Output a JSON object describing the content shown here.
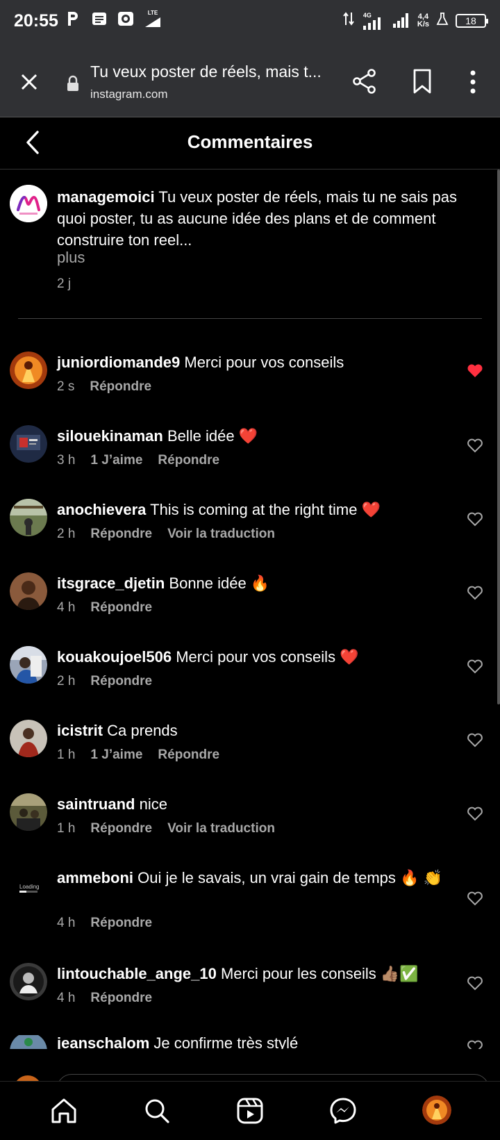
{
  "status_bar": {
    "time": "20:55",
    "lte": "LTE",
    "net_4g": "4G",
    "speed": "4,4",
    "speed_unit": "K/s",
    "battery": "18"
  },
  "browser": {
    "tab_title": "Tu veux poster de réels, mais t...",
    "url": "instagram.com",
    "icons": [
      "close-icon",
      "lock-icon",
      "share-icon",
      "bookmark-icon",
      "more-vertical-icon"
    ]
  },
  "header": {
    "title": "Commentaires"
  },
  "caption": {
    "username": "managemoici",
    "text": "Tu veux poster de réels, mais tu ne sais pas quoi poster, tu as aucune idée des plans et de comment construire ton reel...",
    "more": "plus",
    "time": "2 j"
  },
  "comments": [
    {
      "username": "juniordiomande9",
      "text": "Merci pour vos conseils",
      "time": "2 s",
      "likes": "",
      "reply": "Répondre",
      "translate": "",
      "liked": true
    },
    {
      "username": "silouekinaman",
      "text": "Belle idée ❤️",
      "time": "3 h",
      "likes": "1 J’aime",
      "reply": "Répondre",
      "translate": "",
      "liked": false
    },
    {
      "username": "anochievera",
      "text": "This is coming at the right time ❤️",
      "time": "2 h",
      "likes": "",
      "reply": "Répondre",
      "translate": "Voir la traduction",
      "liked": false
    },
    {
      "username": "itsgrace_djetin",
      "text": "Bonne idée 🔥",
      "time": "4 h",
      "likes": "",
      "reply": "Répondre",
      "translate": "",
      "liked": false
    },
    {
      "username": "kouakoujoel506",
      "text": "Merci pour vos conseils ❤️",
      "time": "2 h",
      "likes": "",
      "reply": "Répondre",
      "translate": "",
      "liked": false
    },
    {
      "username": "icistrit",
      "text": "Ca prends",
      "time": "1 h",
      "likes": "1 J’aime",
      "reply": "Répondre",
      "translate": "",
      "liked": false
    },
    {
      "username": "saintruand",
      "text": "nice",
      "time": "1 h",
      "likes": "",
      "reply": "Répondre",
      "translate": "Voir la traduction",
      "liked": false
    },
    {
      "username": "ammeboni",
      "text": "Oui je le savais, un vrai gain de temps 🔥 👏",
      "time": "4 h",
      "likes": "",
      "reply": "Répondre",
      "translate": "",
      "liked": false
    },
    {
      "username": "lintouchable_ange_10",
      "text": "Merci pour les conseils 👍🏽✅",
      "time": "4 h",
      "likes": "",
      "reply": "Répondre",
      "translate": "",
      "liked": false
    },
    {
      "username": "jeanschalom",
      "text": "Je confirme très stylé",
      "time": "",
      "likes": "",
      "reply": "",
      "translate": "",
      "liked": false
    }
  ],
  "avatar_loading_text": "Loading",
  "bottom_nav": [
    "home-icon",
    "search-icon",
    "reels-icon",
    "messenger-icon",
    "profile-avatar"
  ],
  "colors": {
    "like_red": "#ff3040",
    "meta_gray": "#a8a8a8",
    "chrome_bg": "#303134"
  }
}
